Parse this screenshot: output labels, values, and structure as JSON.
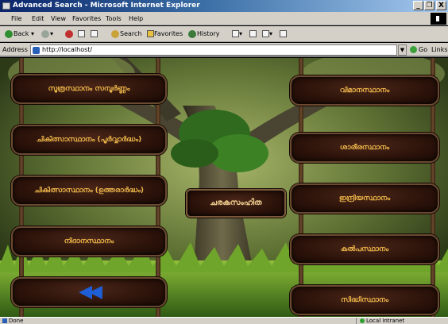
{
  "window": {
    "title": "Advanced Search - Microsoft Internet Explorer",
    "minimize": "_",
    "maximize": "❐",
    "close": "X"
  },
  "menu": {
    "items": [
      "File",
      "Edit",
      "View",
      "Favorites",
      "Tools",
      "Help"
    ]
  },
  "toolbar": {
    "back": "Back",
    "search": "Search",
    "favorites": "Favorites",
    "history": "History"
  },
  "address": {
    "label": "Address",
    "url": "http://localhost/",
    "dropdown": "▼",
    "go": "Go",
    "links": "Links"
  },
  "page": {
    "left_buttons": [
      "സൂത്രസ്ഥാനം സമ്പൂർണ്ണം",
      "ചികിത്സാസ്ഥാനം (പൂർവ്വാർദ്ധം)",
      "ചികിത്സാസ്ഥാനം (ഉത്തരാർദ്ധം)",
      "നിദാനസ്ഥാനം"
    ],
    "center_button": "ചരകസംഹിത",
    "right_buttons": [
      "വിമാനസ്ഥാനം",
      "ശാരീരസ്ഥാനം",
      "ഇന്ദ്രിയസ്ഥാനം",
      "കൽപസ്ഥാനം",
      "സിദ്ധിസ്ഥാനം"
    ],
    "back_icon": "◀◀"
  },
  "status": {
    "left": "Done",
    "right": "Local intranet"
  },
  "colors": {
    "button_text": "#f0b84a",
    "back_arrow": "#1e5fd8",
    "titlebar": "#0a246a"
  }
}
